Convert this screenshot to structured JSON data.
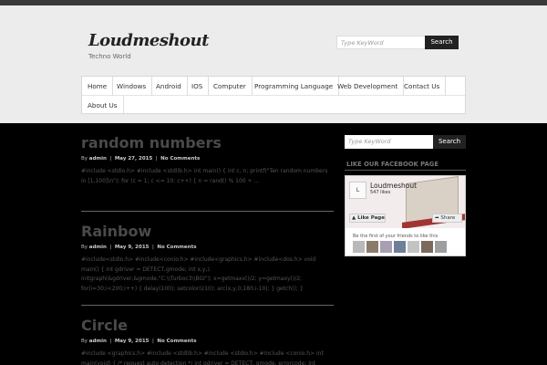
{
  "header": {
    "logo": "Loudmeshout",
    "tagline": "Techno World",
    "search_placeholder": "Type KeyWord",
    "search_button": "Search"
  },
  "nav": {
    "items": [
      "Home",
      "Windows",
      "Android",
      "IOS",
      "Computer",
      "Programming Language",
      "Web Development",
      "Contact Us",
      "About Us"
    ]
  },
  "posts": [
    {
      "title": "random numbers",
      "author": "admin",
      "date": "May 27, 2015",
      "comments": "No Comments",
      "excerpt": "#include <stdio.h> #include <stdlib.h> int main() { int c, n; printf(\"Ten random numbers in [1,100]\\n\"); for (c = 1; c <= 10; c++) { n = rand() % 100 + ..."
    },
    {
      "title": "Rainbow",
      "author": "admin",
      "date": "May 9, 2015",
      "comments": "No Comments",
      "excerpt": "#include<stdio.h> #include<conio.h> #include<graphics.h> #include<dos.h> void main() { int gdriver = DETECT,gmode; int x,y,i; initgraph(&gdriver,&gmode,\"C:\\\\Turboc3\\\\BGI\"); x=getmaxx()/2; y=getmaxy()/2; for(i=30;i<200;i++) { delay(100); setcolor(i/10); arc(x,y,0,180,i-10); } getch(); }"
    },
    {
      "title": "Circle",
      "author": "admin",
      "date": "May 9, 2015",
      "comments": "No Comments",
      "excerpt": "#include <graphics.h> #include <stdlib.h> #include <stdio.h> #include <conio.h> int main(void) { /* request auto detection */ int gdriver = DETECT, gmode, errorcode; int"
    }
  ],
  "sidebar": {
    "search_placeholder": "Type KeyWord",
    "search_button": "Search",
    "widget_title": "LIKE OUR FACEBOOK PAGE",
    "fb": {
      "page_pic": "L",
      "name": "Loudmeshout",
      "likes": "547 likes",
      "like_button": "Like Page",
      "share_button": "Share",
      "friends_text": "Be the first of your friends to like this"
    }
  }
}
